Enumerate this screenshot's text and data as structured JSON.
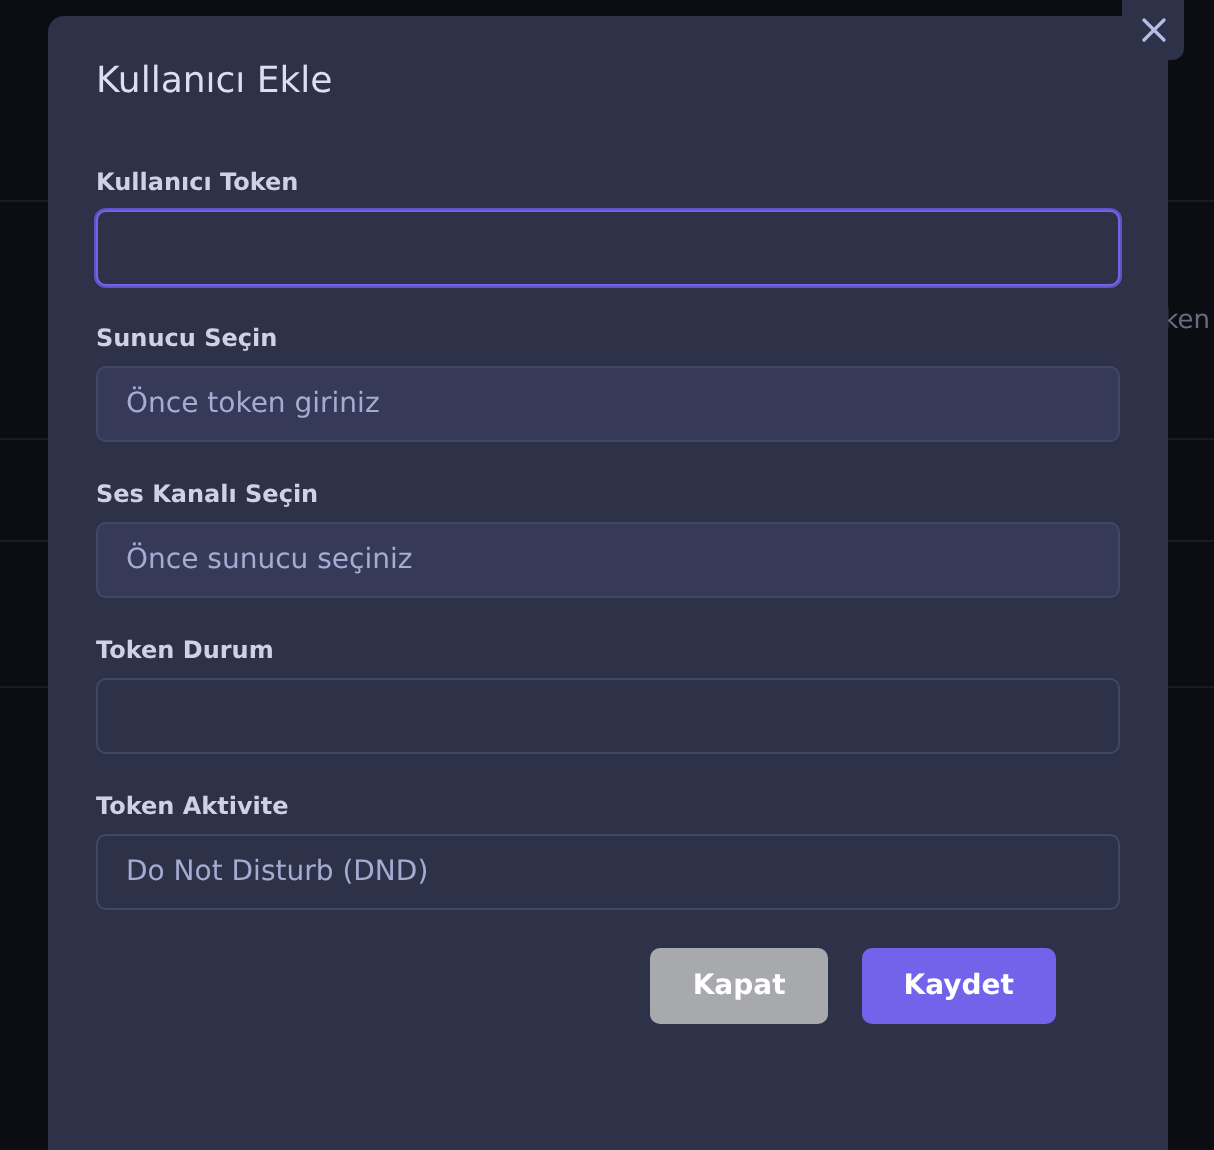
{
  "background": {
    "column_text": "ken"
  },
  "dialog": {
    "title": "Kullanıcı Ekle",
    "fields": [
      {
        "label": "Kullanıcı Token",
        "kind": "input",
        "focused": true,
        "disabled": false
      },
      {
        "label": "Sunucu Seçin",
        "kind": "select",
        "value": "Önce token giriniz",
        "focused": false,
        "disabled": true
      },
      {
        "label": "Ses Kanalı Seçin",
        "kind": "select",
        "value": "Önce sunucu seçiniz",
        "focused": false,
        "disabled": true
      },
      {
        "label": "Token Durum",
        "kind": "input",
        "focused": false,
        "disabled": false
      },
      {
        "label": "Token Aktivite",
        "kind": "select",
        "value": "Do Not Disturb (DND)",
        "focused": false,
        "disabled": false
      }
    ],
    "buttons": [
      {
        "label": "Kapat",
        "kind": "secondary"
      },
      {
        "label": "Kaydet",
        "kind": "primary"
      }
    ]
  }
}
